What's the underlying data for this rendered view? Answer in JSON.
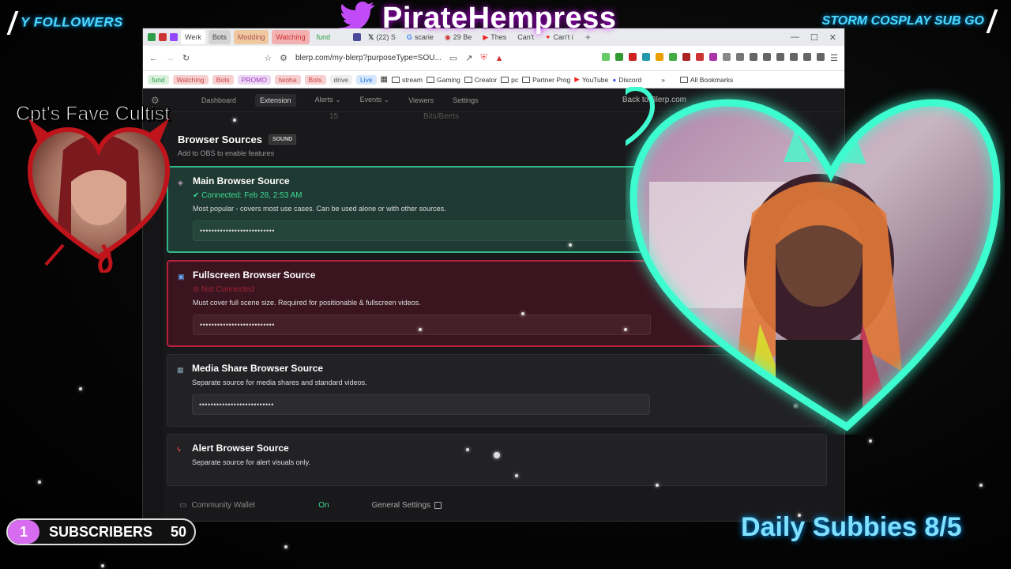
{
  "overlay": {
    "followers": "Y FOLLOWERS",
    "streamer_name": "PirateHempress",
    "goal": "STORM COSPLAY SUB GO",
    "cultist_label": "Cpt's Fave Cultist",
    "daily_subs": "Daily Subbies 8/5",
    "subscribers": {
      "number": "1",
      "label": "SUBSCRIBERS",
      "count": "50"
    }
  },
  "browser": {
    "tabs": [
      {
        "label": "Werk"
      },
      {
        "label": "Bots"
      },
      {
        "label": "Modding"
      },
      {
        "label": "Watching"
      },
      {
        "label": "fund"
      },
      {
        "label": "(22) S"
      },
      {
        "label": "scarie"
      },
      {
        "label": "29 Be"
      },
      {
        "label": "Thes"
      },
      {
        "label": "Can't"
      },
      {
        "label": "Can't i"
      }
    ],
    "url": "blerp.com/my-blerp?purposeType=SOU...",
    "bookmarks": [
      {
        "label": "fund",
        "color": "#2e9d4a"
      },
      {
        "label": "Watching",
        "color": "#c44"
      },
      {
        "label": "Bots",
        "color": "#c44"
      },
      {
        "label": "PROMO",
        "color": "#a03ac0"
      },
      {
        "label": "twoha",
        "color": "#c44"
      },
      {
        "label": "Bots",
        "color": "#c44"
      },
      {
        "label": "drive",
        "color": "#555"
      },
      {
        "label": "Live",
        "color": "#1a73e8"
      }
    ],
    "bookmark_folders": [
      "stream",
      "Gaming",
      "Creator",
      "pc",
      "Partner Prog",
      "YouTube",
      "Discord"
    ],
    "all_bookmarks": "All Bookmarks"
  },
  "app": {
    "nav": [
      "Dashboard",
      "Extension",
      "Alerts",
      "Events",
      "Viewers",
      "Settings"
    ],
    "active_nav": "Extension",
    "back_link": "Back to Blerp.com",
    "faint_top": {
      "number": "15",
      "label": "Bits/Beets"
    },
    "section_title": "Browser Sources",
    "section_badge": "SOUND",
    "section_sub": "Add to OBS to enable features",
    "cards": [
      {
        "title": "Main Browser Source",
        "status": "Connected: Feb 28, 2:53 AM",
        "desc": "Most popular - covers most use cases. Can be used alone or with other sources.",
        "masked": "••••••••••••••••••••••••••",
        "theme": "green"
      },
      {
        "title": "Fullscreen Browser Source",
        "status": "Not Connected",
        "desc": "Must cover full scene size. Required for positionable & fullscreen videos.",
        "masked": "••••••••••••••••••••••••••",
        "theme": "red"
      },
      {
        "title": "Media Share Browser Source",
        "status": "",
        "desc": "Separate source for media shares and standard videos.",
        "masked": "••••••••••••••••••••••••••",
        "theme": "plain"
      },
      {
        "title": "Alert Browser Source",
        "status": "",
        "desc": "Separate source for alert visuals only.",
        "masked": "",
        "theme": "plain"
      }
    ],
    "footer": {
      "wallet": "Community Wallet",
      "wallet_state": "On",
      "general_settings": "General Settings"
    }
  },
  "colors": {
    "accent_cyan": "#4fd8ff",
    "heart_glow": "#3dfccf",
    "connected_green": "#3ddc97",
    "error_red": "#b8203c",
    "sub_pink": "#d86cf0"
  }
}
